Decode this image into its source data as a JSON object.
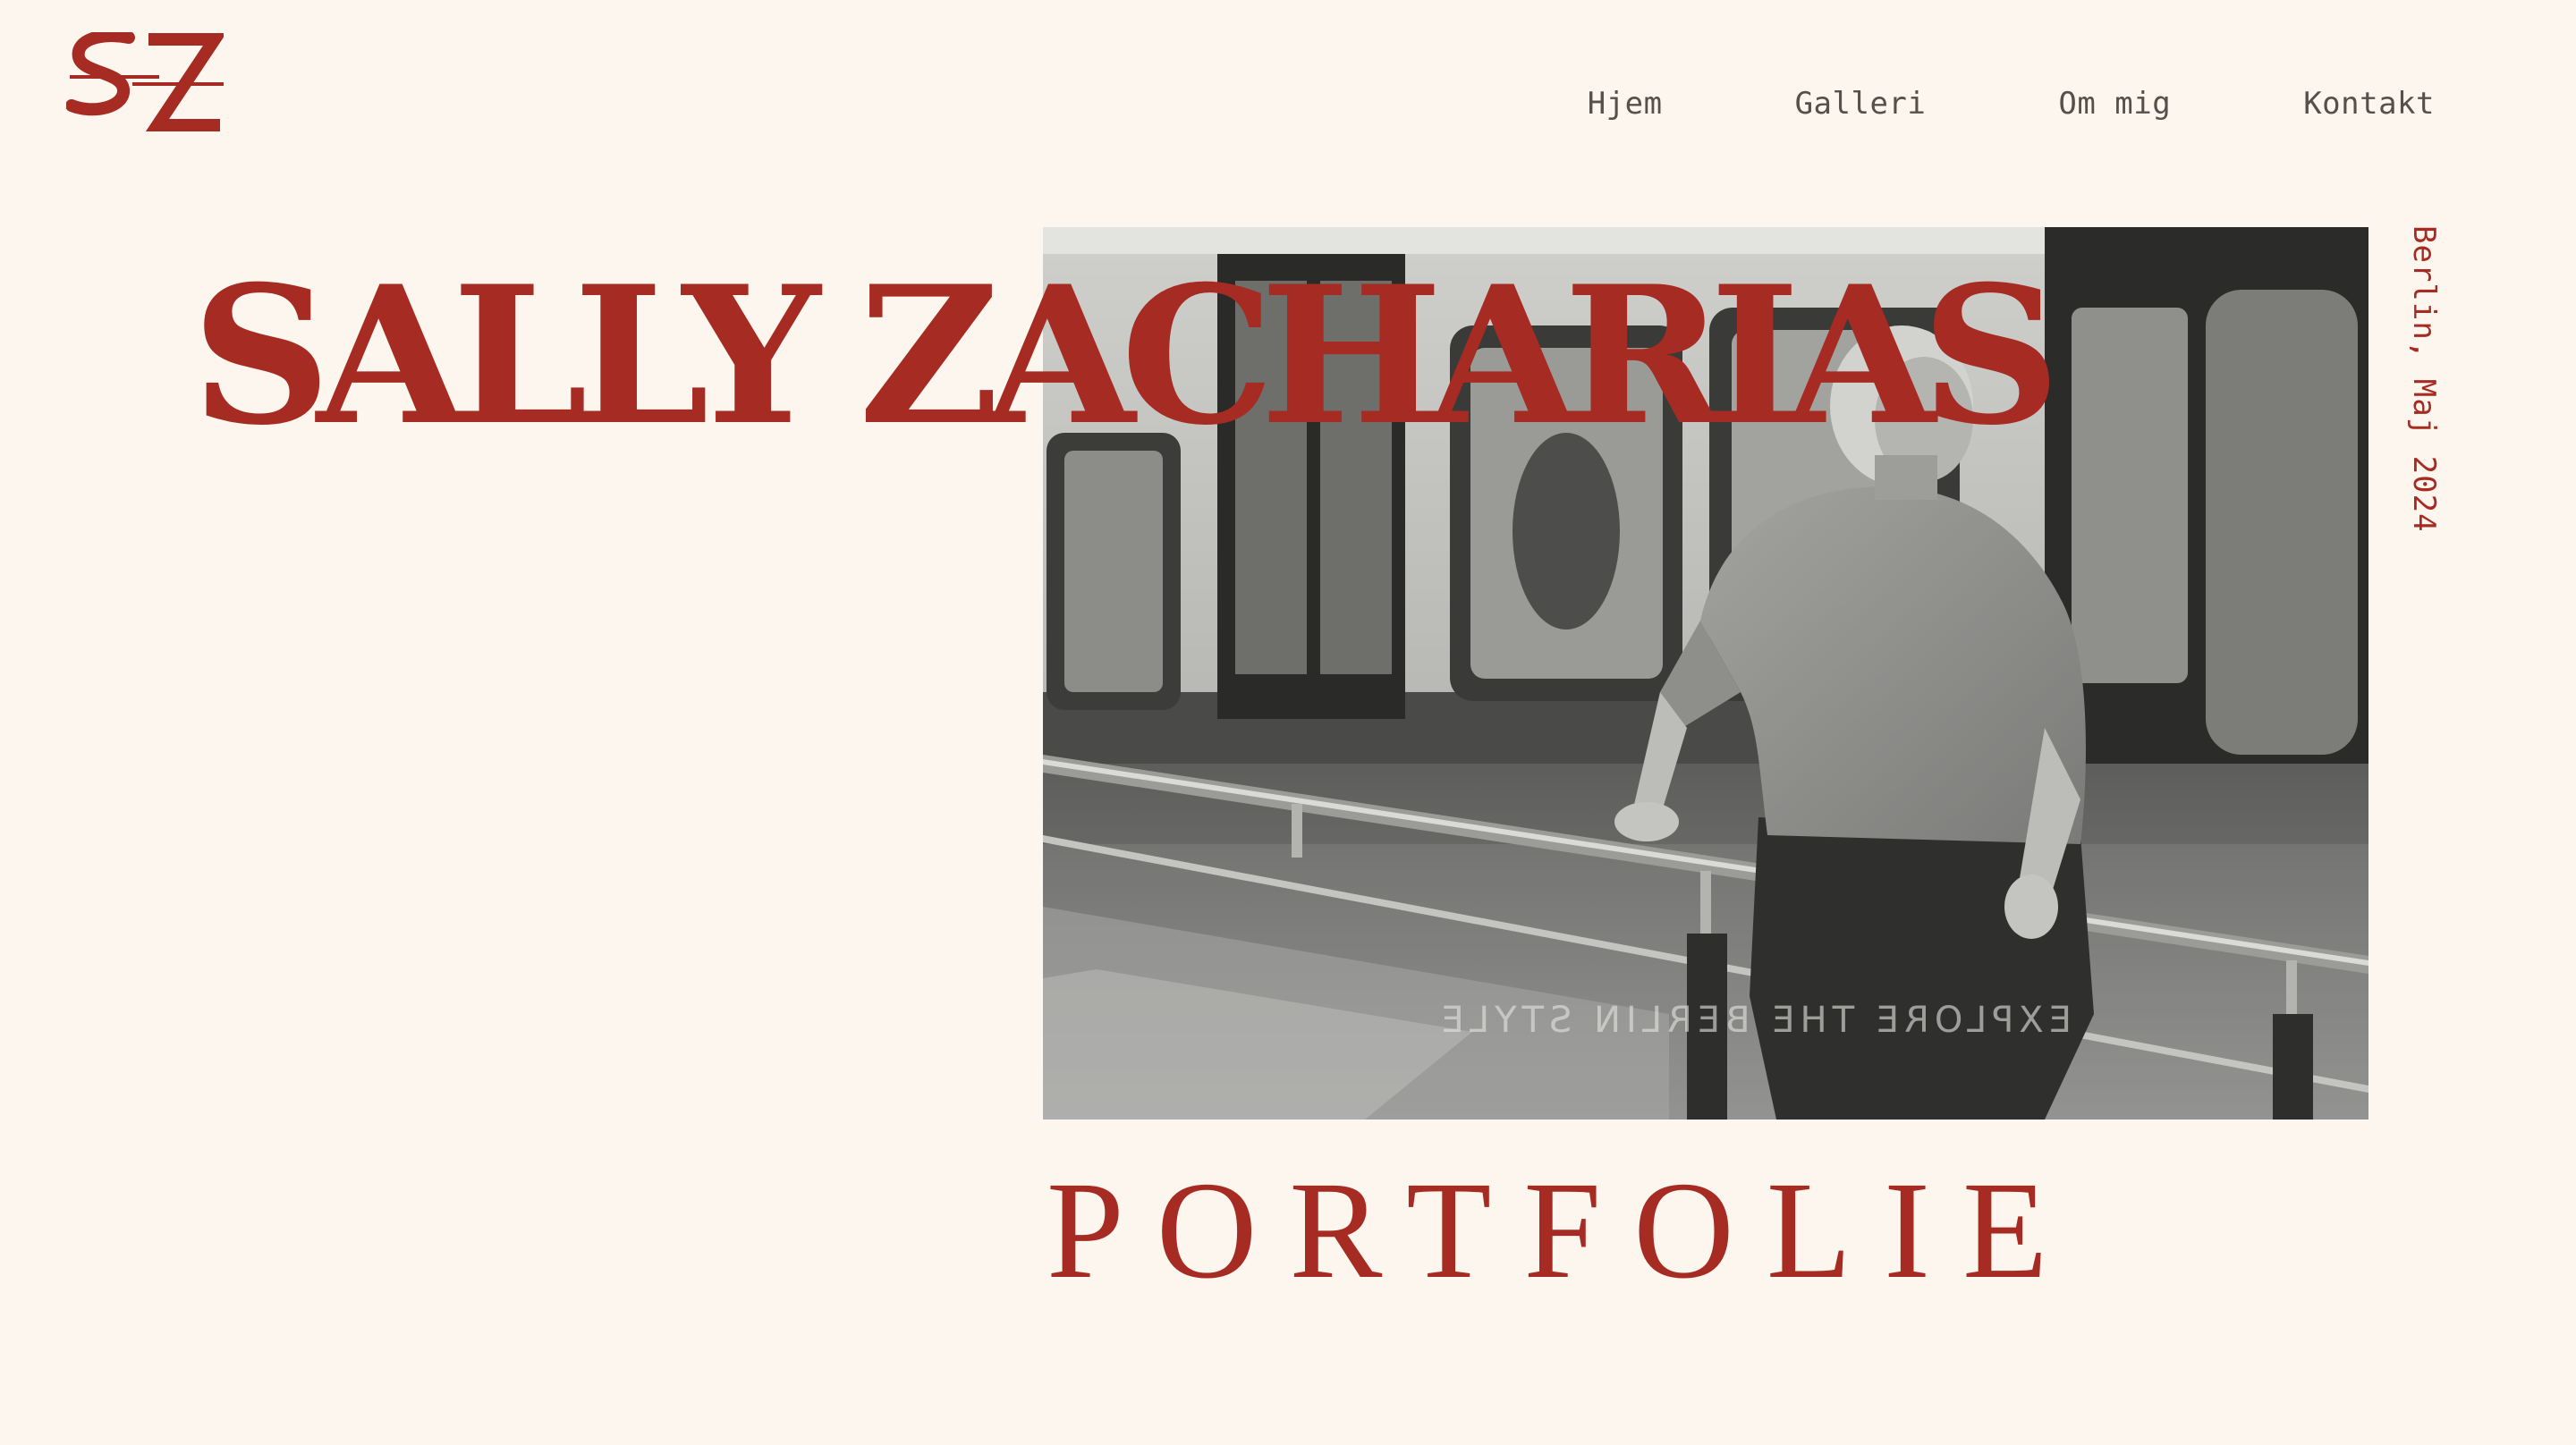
{
  "brand": {
    "logo_text": "SZ",
    "accent_color": "#a62b22",
    "background_color": "#fcf6ee"
  },
  "nav": {
    "items": [
      {
        "label": "Hjem"
      },
      {
        "label": "Galleri"
      },
      {
        "label": "Om mig"
      },
      {
        "label": "Kontakt"
      }
    ]
  },
  "hero": {
    "name": "SALLY ZACHARIAS",
    "side_caption": "Berlin, Maj 2024",
    "subtitle": "PORTFOLIE",
    "photo": {
      "style": "black-and-white",
      "signage_text": "EXPLORE THE BERLIN STYLE"
    }
  }
}
